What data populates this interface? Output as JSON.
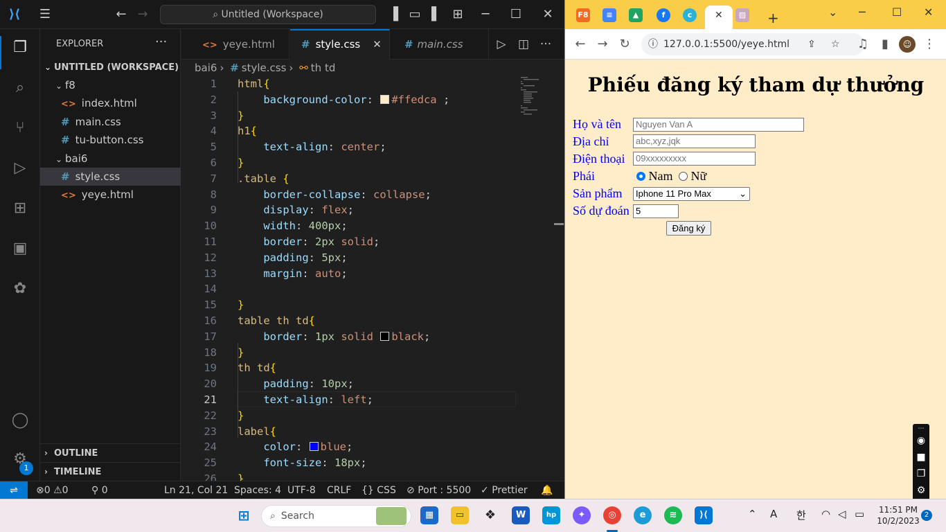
{
  "vscode": {
    "command_center": "Untitled (Workspace)",
    "explorer_title": "EXPLORER",
    "workspace": "UNTITLED (WORKSPACE)",
    "tree": [
      {
        "label": "f8",
        "type": "folder"
      },
      {
        "label": "index.html",
        "type": "html"
      },
      {
        "label": "main.css",
        "type": "css"
      },
      {
        "label": "tu-button.css",
        "type": "css"
      },
      {
        "label": "bai6",
        "type": "folder"
      },
      {
        "label": "style.css",
        "type": "css",
        "selected": true
      },
      {
        "label": "yeye.html",
        "type": "html"
      }
    ],
    "outline": "OUTLINE",
    "timeline": "TIMELINE",
    "tabs": [
      {
        "label": "yeye.html",
        "type": "html"
      },
      {
        "label": "style.css",
        "type": "css",
        "active": true
      },
      {
        "label": "main.css",
        "type": "css"
      }
    ],
    "breadcrumb": [
      "bai6",
      "style.css",
      "th td"
    ],
    "settings_badge": "1",
    "status": {
      "errors": "0",
      "warnings": "0",
      "ports": "0",
      "position": "Ln 21, Col 21",
      "spaces": "Spaces: 4",
      "encoding": "UTF-8",
      "eol": "CRLF",
      "language": "CSS",
      "port": "Port : 5500",
      "prettier": "Prettier"
    }
  },
  "code": [
    {
      "n": "1",
      "t": [
        [
          "sel",
          "html"
        ],
        [
          "br",
          "{"
        ]
      ]
    },
    {
      "n": "2",
      "t": [
        [
          "pad",
          "    "
        ],
        [
          "prop",
          "background-color"
        ],
        [
          "pun",
          ": "
        ],
        [
          "swatch",
          "#ffedca"
        ],
        [
          "val",
          "#ffedca"
        ],
        [
          "pun",
          " ;"
        ]
      ]
    },
    {
      "n": "3",
      "t": [
        [
          "br",
          "}"
        ]
      ]
    },
    {
      "n": "4",
      "t": [
        [
          "sel",
          "h1"
        ],
        [
          "br",
          "{"
        ]
      ]
    },
    {
      "n": "5",
      "t": [
        [
          "pad",
          "    "
        ],
        [
          "prop",
          "text-align"
        ],
        [
          "pun",
          ": "
        ],
        [
          "val",
          "center"
        ],
        [
          "pun",
          ";"
        ]
      ]
    },
    {
      "n": "6",
      "t": [
        [
          "br",
          "}"
        ]
      ]
    },
    {
      "n": "7",
      "t": [
        [
          "sel",
          ".table "
        ],
        [
          "br",
          "{"
        ]
      ]
    },
    {
      "n": "8",
      "t": [
        [
          "pad",
          "    "
        ],
        [
          "prop",
          "border-collapse"
        ],
        [
          "pun",
          ": "
        ],
        [
          "val",
          "collapse"
        ],
        [
          "pun",
          ";"
        ]
      ]
    },
    {
      "n": "9",
      "t": [
        [
          "pad",
          "    "
        ],
        [
          "prop",
          "display"
        ],
        [
          "pun",
          ": "
        ],
        [
          "val",
          "flex"
        ],
        [
          "pun",
          ";"
        ]
      ]
    },
    {
      "n": "10",
      "t": [
        [
          "pad",
          "    "
        ],
        [
          "prop",
          "width"
        ],
        [
          "pun",
          ": "
        ],
        [
          "num",
          "400px"
        ],
        [
          "pun",
          ";"
        ]
      ]
    },
    {
      "n": "11",
      "t": [
        [
          "pad",
          "    "
        ],
        [
          "prop",
          "border"
        ],
        [
          "pun",
          ": "
        ],
        [
          "num",
          "2px"
        ],
        [
          "val",
          " solid"
        ],
        [
          "pun",
          ";"
        ]
      ]
    },
    {
      "n": "12",
      "t": [
        [
          "pad",
          "    "
        ],
        [
          "prop",
          "padding"
        ],
        [
          "pun",
          ": "
        ],
        [
          "num",
          "5px"
        ],
        [
          "pun",
          ";"
        ]
      ]
    },
    {
      "n": "13",
      "t": [
        [
          "pad",
          "    "
        ],
        [
          "prop",
          "margin"
        ],
        [
          "pun",
          ": "
        ],
        [
          "val",
          "auto"
        ],
        [
          "pun",
          ";"
        ]
      ]
    },
    {
      "n": "14",
      "t": []
    },
    {
      "n": "15",
      "t": [
        [
          "br",
          "}"
        ]
      ]
    },
    {
      "n": "16",
      "t": [
        [
          "sel",
          "table th td"
        ],
        [
          "br",
          "{"
        ]
      ]
    },
    {
      "n": "17",
      "t": [
        [
          "pad",
          "    "
        ],
        [
          "prop",
          "border"
        ],
        [
          "pun",
          ": "
        ],
        [
          "num",
          "1px"
        ],
        [
          "val",
          " solid "
        ],
        [
          "swatch",
          "#000000"
        ],
        [
          "val",
          "black"
        ],
        [
          "pun",
          ";"
        ]
      ]
    },
    {
      "n": "18",
      "t": [
        [
          "br",
          "}"
        ]
      ]
    },
    {
      "n": "19",
      "t": [
        [
          "sel",
          "th td"
        ],
        [
          "br",
          "{"
        ]
      ]
    },
    {
      "n": "20",
      "t": [
        [
          "pad",
          "    "
        ],
        [
          "prop",
          "padding"
        ],
        [
          "pun",
          ": "
        ],
        [
          "num",
          "10px"
        ],
        [
          "pun",
          ";"
        ]
      ]
    },
    {
      "n": "21",
      "t": [
        [
          "pad",
          "    "
        ],
        [
          "prop",
          "text-align"
        ],
        [
          "pun",
          ": "
        ],
        [
          "val",
          "left"
        ],
        [
          "pun",
          ";"
        ]
      ]
    },
    {
      "n": "22",
      "t": [
        [
          "br",
          "}"
        ]
      ]
    },
    {
      "n": "23",
      "t": [
        [
          "sel",
          "label"
        ],
        [
          "br",
          "{"
        ]
      ]
    },
    {
      "n": "24",
      "t": [
        [
          "pad",
          "    "
        ],
        [
          "prop",
          "color"
        ],
        [
          "pun",
          ": "
        ],
        [
          "swatch",
          "#0000ff"
        ],
        [
          "val",
          "blue"
        ],
        [
          "pun",
          ";"
        ]
      ]
    },
    {
      "n": "25",
      "t": [
        [
          "pad",
          "    "
        ],
        [
          "prop",
          "font-size"
        ],
        [
          "pun",
          ": "
        ],
        [
          "num",
          "18px"
        ],
        [
          "pun",
          ";"
        ]
      ]
    },
    {
      "n": "26",
      "t": [
        [
          "br",
          "}"
        ]
      ]
    }
  ],
  "browser": {
    "url": "127.0.0.1:5500/yeye.html",
    "tab_f8": "F8",
    "page": {
      "title": "Phiếu đăng ký tham dự thưởng",
      "labels": [
        "Họ và tên",
        "Địa chỉ",
        "Điện thoại",
        "Phái",
        "Sản phẩm",
        "Số dự đoán"
      ],
      "name_placeholder": "Nguyen Van A",
      "address_placeholder": "abc,xyz,jqk",
      "phone_placeholder": "09xxxxxxxxx",
      "gender_male": "Nam",
      "gender_female": "Nữ",
      "product": "Iphone 11 Pro Max",
      "guess": "5",
      "submit": "Đăng ký"
    }
  },
  "taskbar": {
    "search": "Search",
    "time": "11:51 PM",
    "date": "10/2/2023",
    "notifications": "2",
    "lang": "한"
  }
}
